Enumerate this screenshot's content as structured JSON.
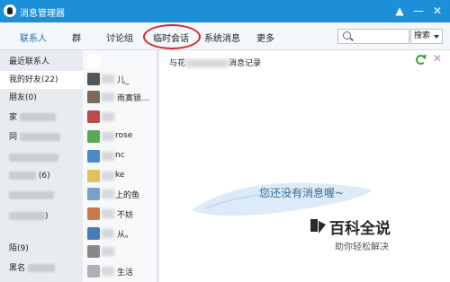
{
  "window": {
    "title": "消息管理器"
  },
  "title_bar": {
    "minimize": "▲",
    "maximize": "—",
    "close": "✕"
  },
  "nav": {
    "tabs": [
      {
        "label": "联系人",
        "active": true
      },
      {
        "label": "群"
      },
      {
        "label": "讨论组"
      },
      {
        "label": "临时会话",
        "highlighted": true
      },
      {
        "label": "系统消息"
      },
      {
        "label": "更多"
      }
    ],
    "search_value": "",
    "search_button": "搜索"
  },
  "groups": [
    {
      "label": "最近联系人",
      "selected": false
    },
    {
      "label": "我的好友(22)",
      "selected": true
    },
    {
      "label": "朋友(0)"
    },
    {
      "label": "家"
    },
    {
      "label": "同"
    },
    {
      "label": ""
    },
    {
      "label": "(6)"
    },
    {
      "label": ""
    },
    {
      "label": ")"
    },
    {
      "label": "陌(9)"
    },
    {
      "label": "黑名"
    }
  ],
  "contacts": [
    {
      "name": "",
      "avatar_color": "#ffffff"
    },
    {
      "name": "儿_",
      "avatar_color": "#555555"
    },
    {
      "name": "雨寞锁...",
      "avatar_color": "#7a6a5a"
    },
    {
      "name": "",
      "avatar_color": "#b84b4b"
    },
    {
      "name": "rose",
      "avatar_color": "#5aa85a"
    },
    {
      "name": "nc",
      "avatar_color": "#4a88c8"
    },
    {
      "name": "ke",
      "avatar_color": "#e0c25a"
    },
    {
      "name": "上的鱼",
      "avatar_color": "#7aa0c8"
    },
    {
      "name": "不妨",
      "avatar_color": "#c87a4a"
    },
    {
      "name": "从。",
      "avatar_color": "#4a7ab8"
    },
    {
      "name": "",
      "avatar_color": "#888888"
    },
    {
      "name": "生活",
      "avatar_color": "#b0b0b0"
    }
  ],
  "chat": {
    "title_prefix": "与花",
    "title_suffix": "消息记录",
    "empty_message": "您还没有消息喔~"
  },
  "watermark": {
    "title": "百科全说",
    "subtitle": "助你轻松解决"
  },
  "colors": {
    "titlebar": "#1d8fd8",
    "highlight_ring": "#d32a2a",
    "accent_tab": "#1d6fb8"
  },
  "icons": {
    "refresh": "refresh-icon",
    "delete": "delete-icon",
    "search": "search-icon"
  }
}
